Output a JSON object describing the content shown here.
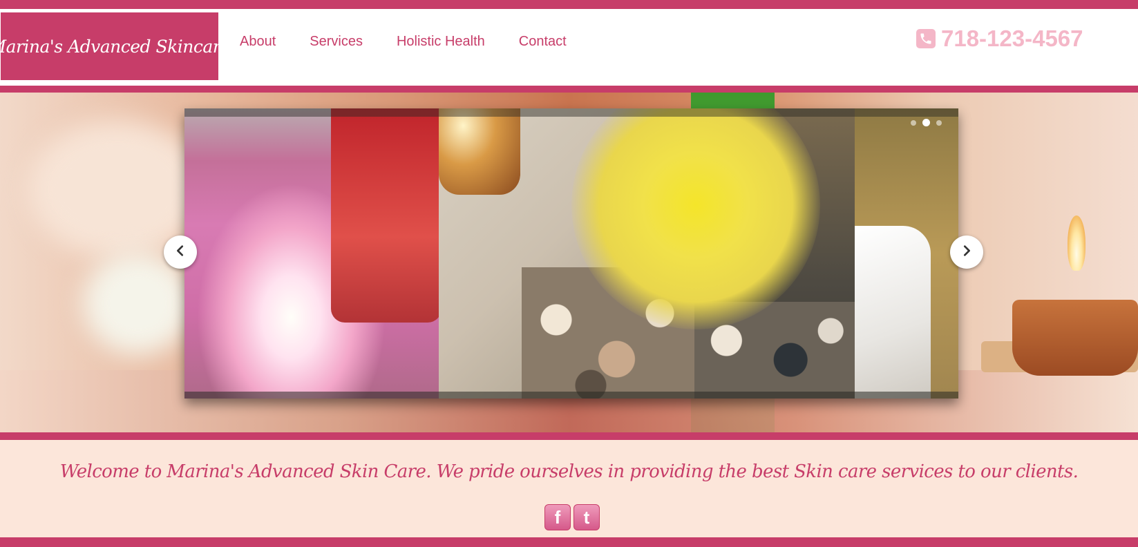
{
  "header": {
    "logo_text": "Marina's Advanced Skincare",
    "nav": [
      "About",
      "Services",
      "Holistic Health",
      "Contact"
    ],
    "phone": "718-123-4567",
    "phone_icon": "phone-icon"
  },
  "slider": {
    "prev_icon": "chevron-left-icon",
    "next_icon": "chevron-right-icon",
    "slide_count": 3,
    "active_slide": 2
  },
  "welcome": {
    "text": "Welcome to Marina's Advanced Skin Care. We pride ourselves in providing the best Skin care services to our clients.",
    "social": [
      {
        "letter": "f",
        "icon": "facebook-icon"
      },
      {
        "letter": "t",
        "icon": "twitter-icon"
      }
    ]
  },
  "colors": {
    "brand": "#c73d69",
    "phone": "#f4b6c7",
    "welcome_bg": "#fce6da"
  }
}
